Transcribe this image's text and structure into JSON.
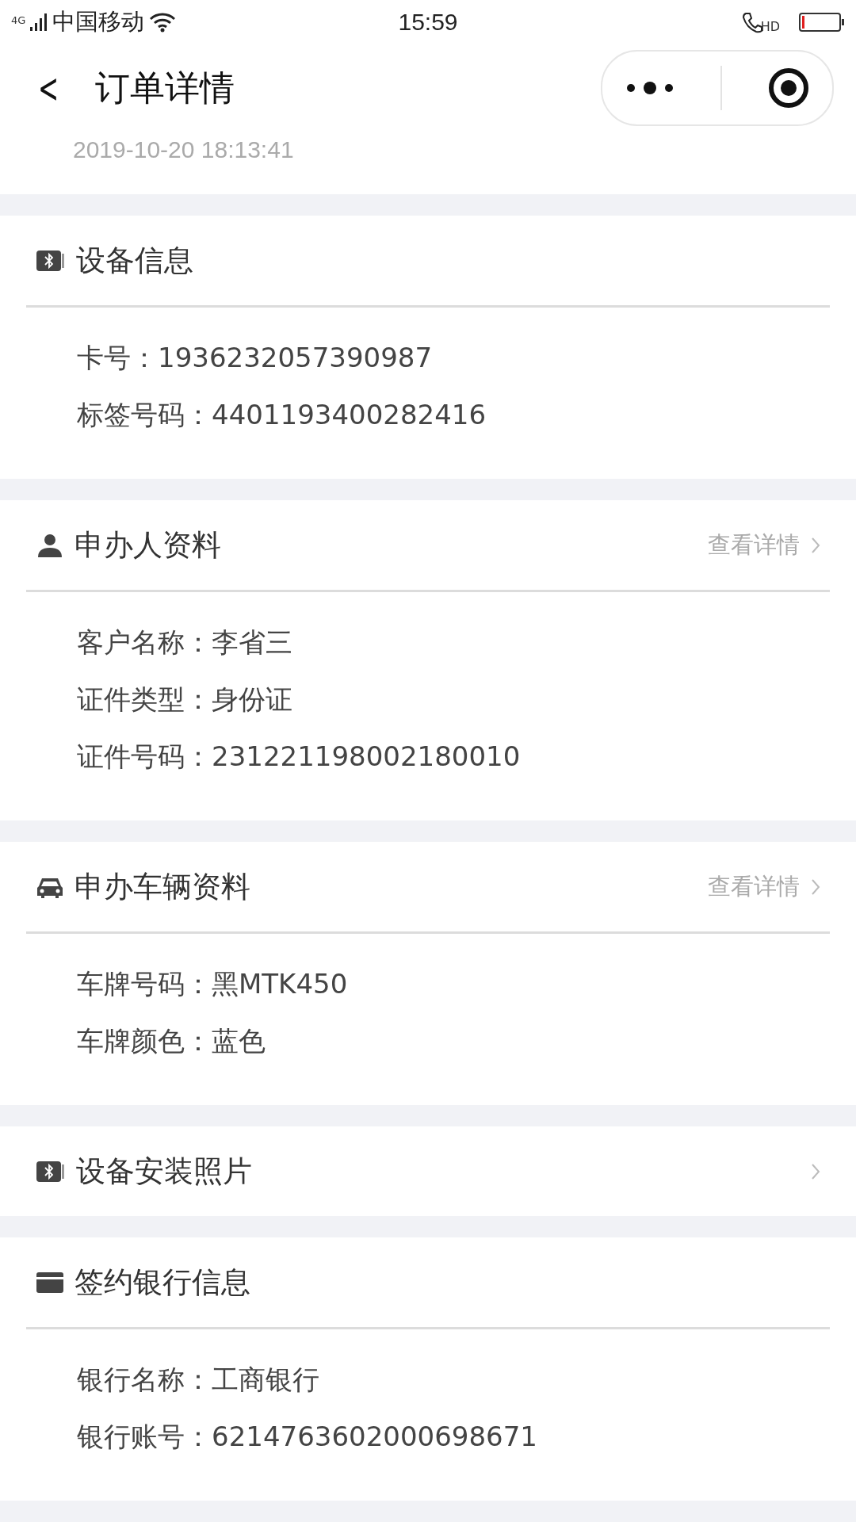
{
  "status_bar": {
    "network": "4G",
    "carrier": "中国移动",
    "time": "15:59",
    "call_badge": "HD"
  },
  "nav": {
    "back": "<",
    "title": "订单详情"
  },
  "order_time": "2019-10-20 18:13:41",
  "sections": [
    {
      "kind": "device",
      "title": "设备信息",
      "rows": [
        "卡号：1936232057390987",
        "标签号码：4401193400282416"
      ]
    },
    {
      "kind": "applicant",
      "title": "申办人资料",
      "action": "查看详情",
      "rows": [
        "客户名称：李省三",
        "证件类型：身份证",
        "证件号码：231221198002180010"
      ]
    },
    {
      "kind": "vehicle",
      "title": "申办车辆资料",
      "action": "查看详情",
      "rows": [
        "车牌号码：黑MTK450",
        "车牌颜色：蓝色"
      ]
    },
    {
      "kind": "photos",
      "title": "设备安装照片",
      "link": true
    },
    {
      "kind": "bank",
      "title": "签约银行信息",
      "rows": [
        "银行名称：工商银行",
        "银行账号：6214763602000698671"
      ]
    }
  ]
}
